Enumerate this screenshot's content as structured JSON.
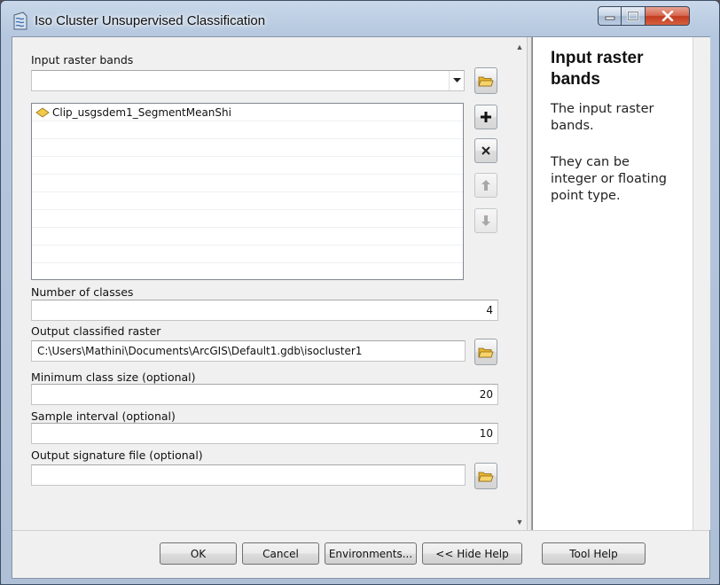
{
  "window": {
    "title": "Iso Cluster Unsupervised Classification",
    "minimize_icon": "minimize-icon",
    "maximize_icon": "maximize-icon",
    "close_icon": "close-icon"
  },
  "form": {
    "input_bands": {
      "label": "Input raster bands",
      "value": "",
      "items": [
        "Clip_usgsdem1_SegmentMeanShi"
      ]
    },
    "num_classes": {
      "label": "Number of classes",
      "value": "4"
    },
    "output_raster": {
      "label": "Output classified raster",
      "value": "C:\\Users\\Mathini\\Documents\\ArcGIS\\Default1.gdb\\isocluster1"
    },
    "min_class_size": {
      "label": "Minimum class size (optional)",
      "value": "20"
    },
    "sample_interval": {
      "label": "Sample interval (optional)",
      "value": "10"
    },
    "signature_file": {
      "label": "Output signature file (optional)",
      "value": ""
    }
  },
  "help": {
    "title": "Input raster bands",
    "paragraphs": [
      "The input raster bands.",
      "They can be integer or floating point type."
    ]
  },
  "buttons": {
    "ok": "OK",
    "cancel": "Cancel",
    "environments": "Environments...",
    "hide_help": "<< Hide Help",
    "tool_help": "Tool Help"
  },
  "colors": {
    "folder": "#e8b52e",
    "add_plus": "#111111",
    "layer_icon": "#f2c94c"
  }
}
